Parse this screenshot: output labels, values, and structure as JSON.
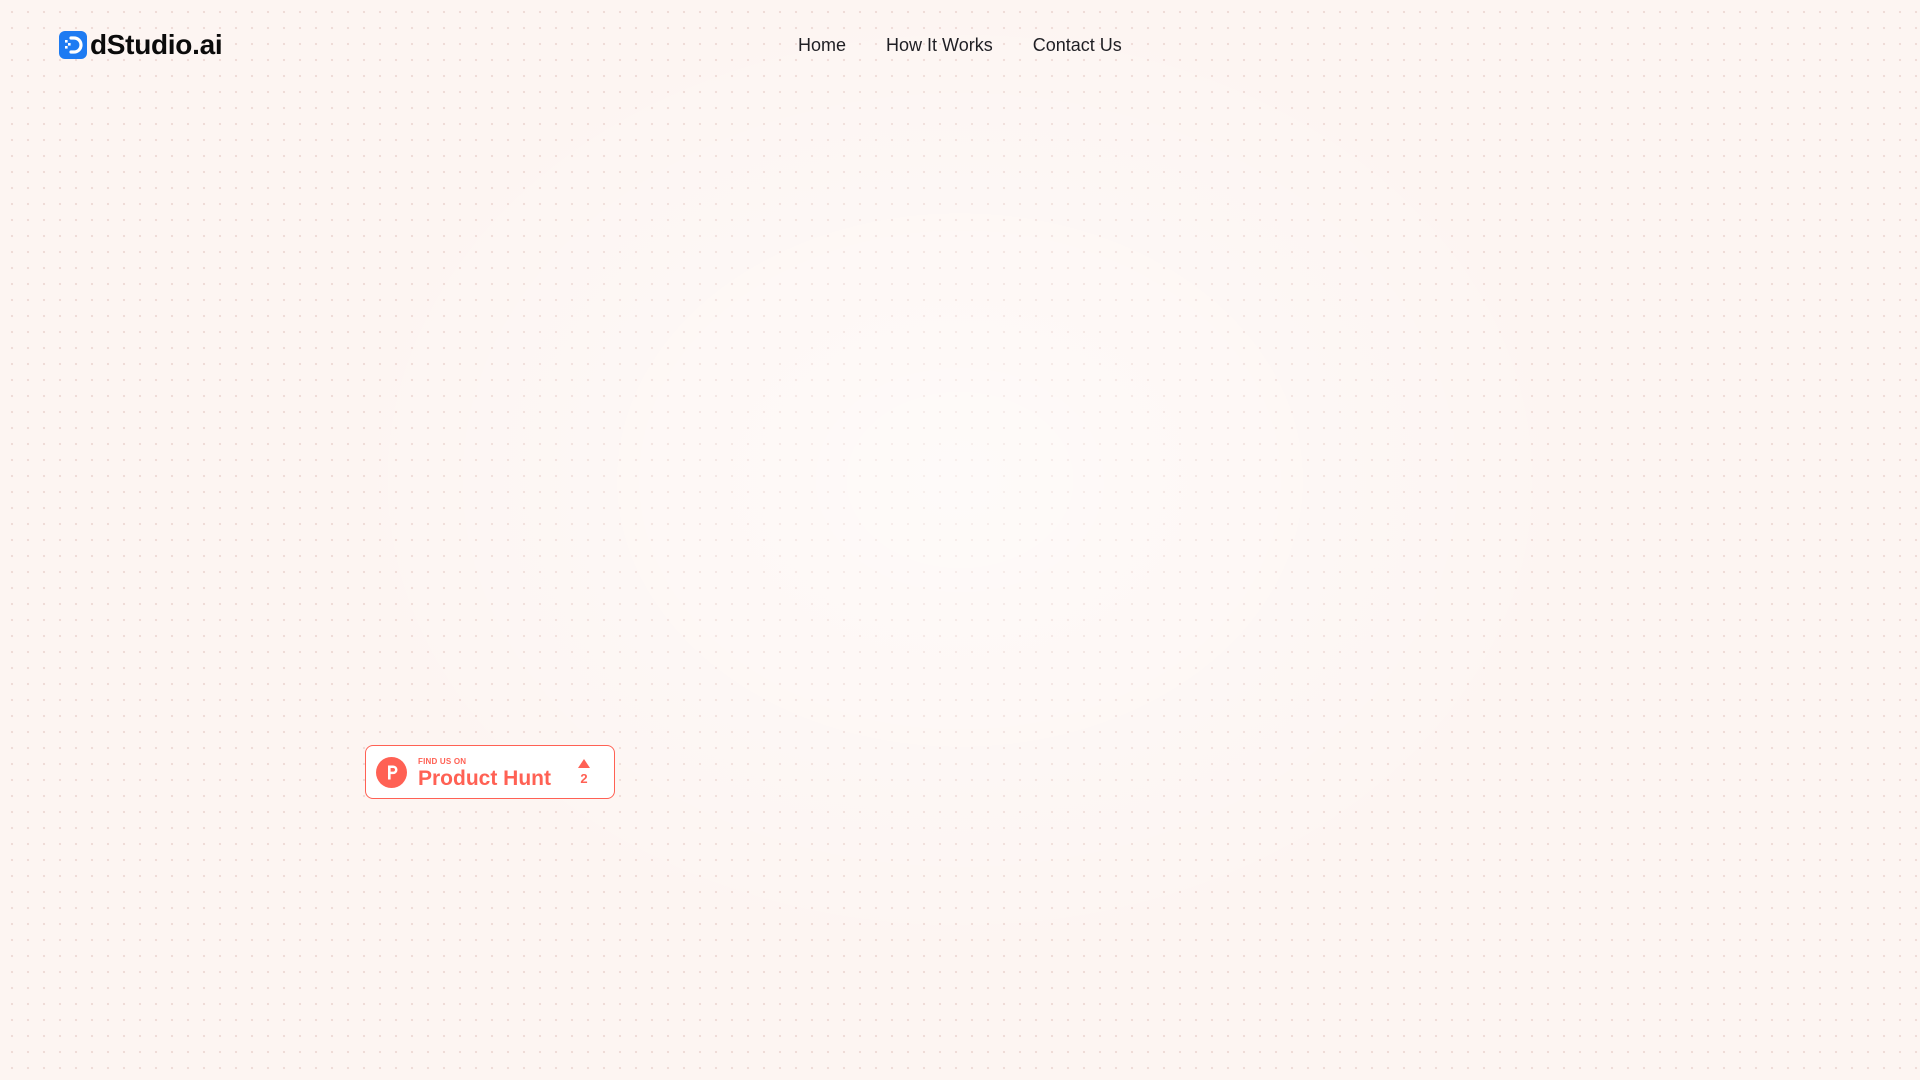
{
  "brand": {
    "name": "dStudio.ai",
    "logo_icon": "dstudio-logo-icon",
    "logo_color": "#1e7bf2"
  },
  "nav": {
    "items": [
      {
        "label": "Home"
      },
      {
        "label": "How It Works"
      },
      {
        "label": "Contact Us"
      }
    ]
  },
  "product_hunt_badge": {
    "kicker": "FIND US ON",
    "title": "Product Hunt",
    "vote_count": "2",
    "logo_icon": "product-hunt-icon",
    "upvote_icon": "upvote-triangle-icon",
    "accent_color": "#ff6154"
  },
  "colors": {
    "background": "#fdf5f2",
    "text": "#1f1f24"
  }
}
